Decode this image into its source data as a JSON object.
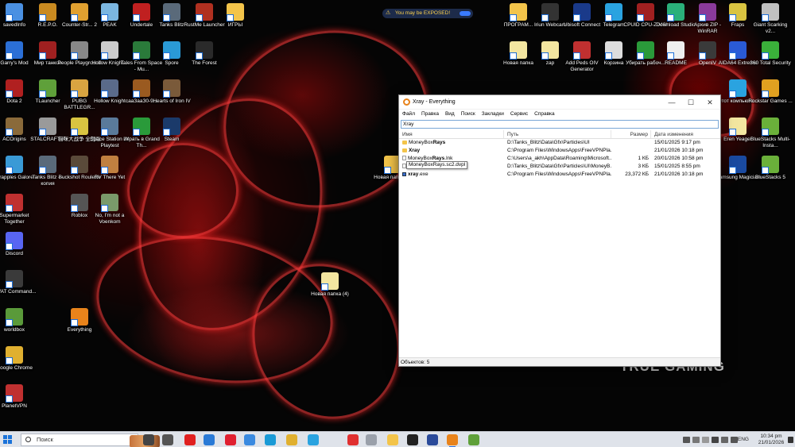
{
  "desktop": {
    "icons": [
      {
        "label": "savedInfo",
        "color": "#4a90e2"
      },
      {
        "label": "R.E.P.O.",
        "color": "#c98a20"
      },
      {
        "label": "Counter-Str... 2",
        "color": "#e0a030"
      },
      {
        "label": "PEAK",
        "color": "#7bb6e0"
      },
      {
        "label": "Undertale",
        "color": "#c02020"
      },
      {
        "label": "Tanks Blitz",
        "color": "#5a6a7a"
      },
      {
        "label": "RustMe Launcher",
        "color": "#b03020"
      },
      {
        "label": "ИГРЫ",
        "color": "#f3c44a"
      },
      {
        "label": "Garry's Mod",
        "color": "#2b6fd6"
      },
      {
        "label": "Мир танков",
        "color": "#a02020"
      },
      {
        "label": "People Playground",
        "color": "#888888"
      },
      {
        "label": "Hollow Knight...",
        "color": "#cccccc"
      },
      {
        "label": "Tales From Space - Mu...",
        "color": "#2a7a3a"
      },
      {
        "label": "Spore",
        "color": "#2a9ad6"
      },
      {
        "label": "The Forest",
        "color": "#2a2a2a"
      },
      {
        "label": "Dota 2",
        "color": "#b02020"
      },
      {
        "label": "TLauncher",
        "color": "#5fa03a"
      },
      {
        "label": "PUBG BATTLEGR...",
        "color": "#d9a441"
      },
      {
        "label": "Hollow Knight",
        "color": "#5a6a8a"
      },
      {
        "label": "сааЗааЗ0-9...",
        "color": "#9a5a20"
      },
      {
        "label": "Hearts of Iron IV",
        "color": "#7a5a3a"
      },
      {
        "label": "ACOrigins",
        "color": "#8a6a3a"
      },
      {
        "label": "STALCRAFT X",
        "color": "#9a9a9a"
      },
      {
        "label": "猫咪大战争 全国版",
        "color": "#d9c441"
      },
      {
        "label": "Space Station 14 Playtest",
        "color": "#5a7a9a"
      },
      {
        "label": "Играть в Grand Th...",
        "color": "#2a9a3a"
      },
      {
        "label": "Steam",
        "color": "#1b3a6a"
      },
      {
        "label": "Grapples Galore",
        "color": "#3a9ad6"
      },
      {
        "label": "Tanks Blitz — копия",
        "color": "#5a6a7a"
      },
      {
        "label": "Buckshot Roulette",
        "color": "#5a4a3a"
      },
      {
        "label": "RV There Yet",
        "color": "#c08040"
      },
      {
        "label": "Roblox",
        "color": "#555555"
      },
      {
        "label": "No, I'm not a Voenkom",
        "color": "#7a9a6a"
      },
      {
        "label": "Supermarket Together",
        "color": "#c03030"
      },
      {
        "label": "Discord",
        "color": "#5865f2"
      },
      {
        "label": "SWAT Command...",
        "color": "#3a3a3a"
      },
      {
        "label": "worldbox",
        "color": "#5a9a3a"
      },
      {
        "label": "Everything",
        "color": "#e8831b"
      },
      {
        "label": "Google Chrome",
        "color": "#e0b030"
      },
      {
        "label": "PlanetVPN",
        "color": "#c03030"
      },
      {
        "label": "Новая папка (5)",
        "color": "#f3c44a"
      },
      {
        "label": "Новая папка (4)",
        "color": "#f3e6a0"
      },
      {
        "label": "ПРОГРАМ...",
        "color": "#f3c44a"
      },
      {
        "label": "Iriun Webcam",
        "color": "#333333"
      },
      {
        "label": "Ubisoft Connect",
        "color": "#1a3a8a"
      },
      {
        "label": "Telegram",
        "color": "#2aa3e0"
      },
      {
        "label": "CPUID CPU-Z MSI",
        "color": "#a02020"
      },
      {
        "label": "Download Studio",
        "color": "#2ab07a"
      },
      {
        "label": "Архив ZIP - WinRAR",
        "color": "#8a3a9a"
      },
      {
        "label": "Fraps",
        "color": "#d9c441"
      },
      {
        "label": "Giant Scarking v2...",
        "color": "#c0c0c0"
      },
      {
        "label": "Новая папка",
        "color": "#f3e6a0"
      },
      {
        "label": "zap",
        "color": "#f3e6a0"
      },
      {
        "label": "Add Peds OIV Generator",
        "color": "#c03030"
      },
      {
        "label": "Корзина",
        "color": "#dddddd"
      },
      {
        "label": "Убирать рабоч...",
        "color": "#2a9a3a"
      },
      {
        "label": "README",
        "color": "#eeeeee"
      },
      {
        "label": "OpenIV",
        "color": "#3a3a3a"
      },
      {
        "label": "AIDA64 Extreme",
        "color": "#2a5ad6"
      },
      {
        "label": "360 Total Security",
        "color": "#3ab03a"
      },
      {
        "label": "Этот компьюте...",
        "color": "#2aa3e0"
      },
      {
        "label": "Eren Yeager",
        "color": "#f3e6a0"
      },
      {
        "label": "BlueStacks Multi-Insta...",
        "color": "#6ab03a"
      },
      {
        "label": "Rockstar Games ...",
        "color": "#e0a020"
      },
      {
        "label": "Samsung Magician",
        "color": "#1a4aa0"
      },
      {
        "label": "BlueStacks 5",
        "color": "#6ab03a"
      }
    ],
    "notification": "You may be EXPOSED!",
    "wallpaper_brand": "TRUE GAMING"
  },
  "window": {
    "title": "Xray - Everything",
    "menu": [
      "Файл",
      "Правка",
      "Вид",
      "Поиск",
      "Закладки",
      "Сервис",
      "Справка"
    ],
    "search_value": "Xray",
    "columns": {
      "name": "Имя",
      "path": "Путь",
      "size": "Размер",
      "date": "Дата изменения"
    },
    "rows": [
      {
        "name_pre": "MoneyBox",
        "name_bold": "Rays",
        "name_post": "",
        "type": "folder",
        "path": "D:\\Tanks_Blitz\\Data\\Gfx\\Particles\\UI",
        "size": "",
        "date": "15/01/2025 9:17 pm"
      },
      {
        "name_pre": "",
        "name_bold": "Xray",
        "name_post": "",
        "type": "folder",
        "path": "C:\\Program Files\\WindowsApps\\FreeVPNPla...",
        "size": "",
        "date": "21/01/2026 10:18 pm"
      },
      {
        "name_pre": "MoneyBox",
        "name_bold": "Rays",
        "name_post": ".lnk",
        "type": "file",
        "path": "C:\\Users\\a_akh\\AppData\\Roaming\\Microsoft...",
        "size": "1 КБ",
        "date": "20/01/2026 10:58 pm"
      },
      {
        "name_pre": "MoneyBox",
        "name_bold": "Rays",
        "name_post": ".sc2.dvpl",
        "type": "file",
        "path": "D:\\Tanks_Blitz\\Data\\Gfx\\Particles\\UI\\MoneyB...",
        "size": "3 КБ",
        "date": "15/01/2025 8:55 pm"
      },
      {
        "name_pre": "",
        "name_bold": "xray",
        "name_post": ".exe",
        "type": "exe",
        "path": "C:\\Program Files\\WindowsApps\\FreeVPNPla...",
        "size": "23,372 КБ",
        "date": "21/01/2026 10:18 pm"
      }
    ],
    "tooltip": "MoneyBoxRays.sc2.dvpl",
    "status": "Объектов: 5"
  },
  "taskbar": {
    "search_placeholder": "Поиск",
    "apps": [
      {
        "name": "task-view",
        "color": "#444444"
      },
      {
        "name": "widgets",
        "color": "#555555"
      },
      {
        "name": "yandex",
        "color": "#e02020"
      },
      {
        "name": "screen-capture",
        "color": "#2a7ad6"
      },
      {
        "name": "opera",
        "color": "#e02030"
      },
      {
        "name": "folder-cloud",
        "color": "#3a8ae0"
      },
      {
        "name": "edge",
        "color": "#1a9ad6"
      },
      {
        "name": "chrome",
        "color": "#e0b030"
      },
      {
        "name": "telegram",
        "color": "#2aa3e0"
      },
      {
        "name": "yandex-browser",
        "color": "#e03030"
      },
      {
        "name": "cloud-folder",
        "color": "#9aa0aa"
      },
      {
        "name": "file-explorer",
        "color": "#f3c44a"
      },
      {
        "name": "terminal",
        "color": "#222222"
      },
      {
        "name": "media-app",
        "color": "#2a4a9a"
      },
      {
        "name": "everything",
        "color": "#e8831b"
      },
      {
        "name": "minecraft",
        "color": "#5fa03a"
      }
    ],
    "lang": "ENG",
    "time": "10:34 pm",
    "date": "21/01/2026"
  }
}
